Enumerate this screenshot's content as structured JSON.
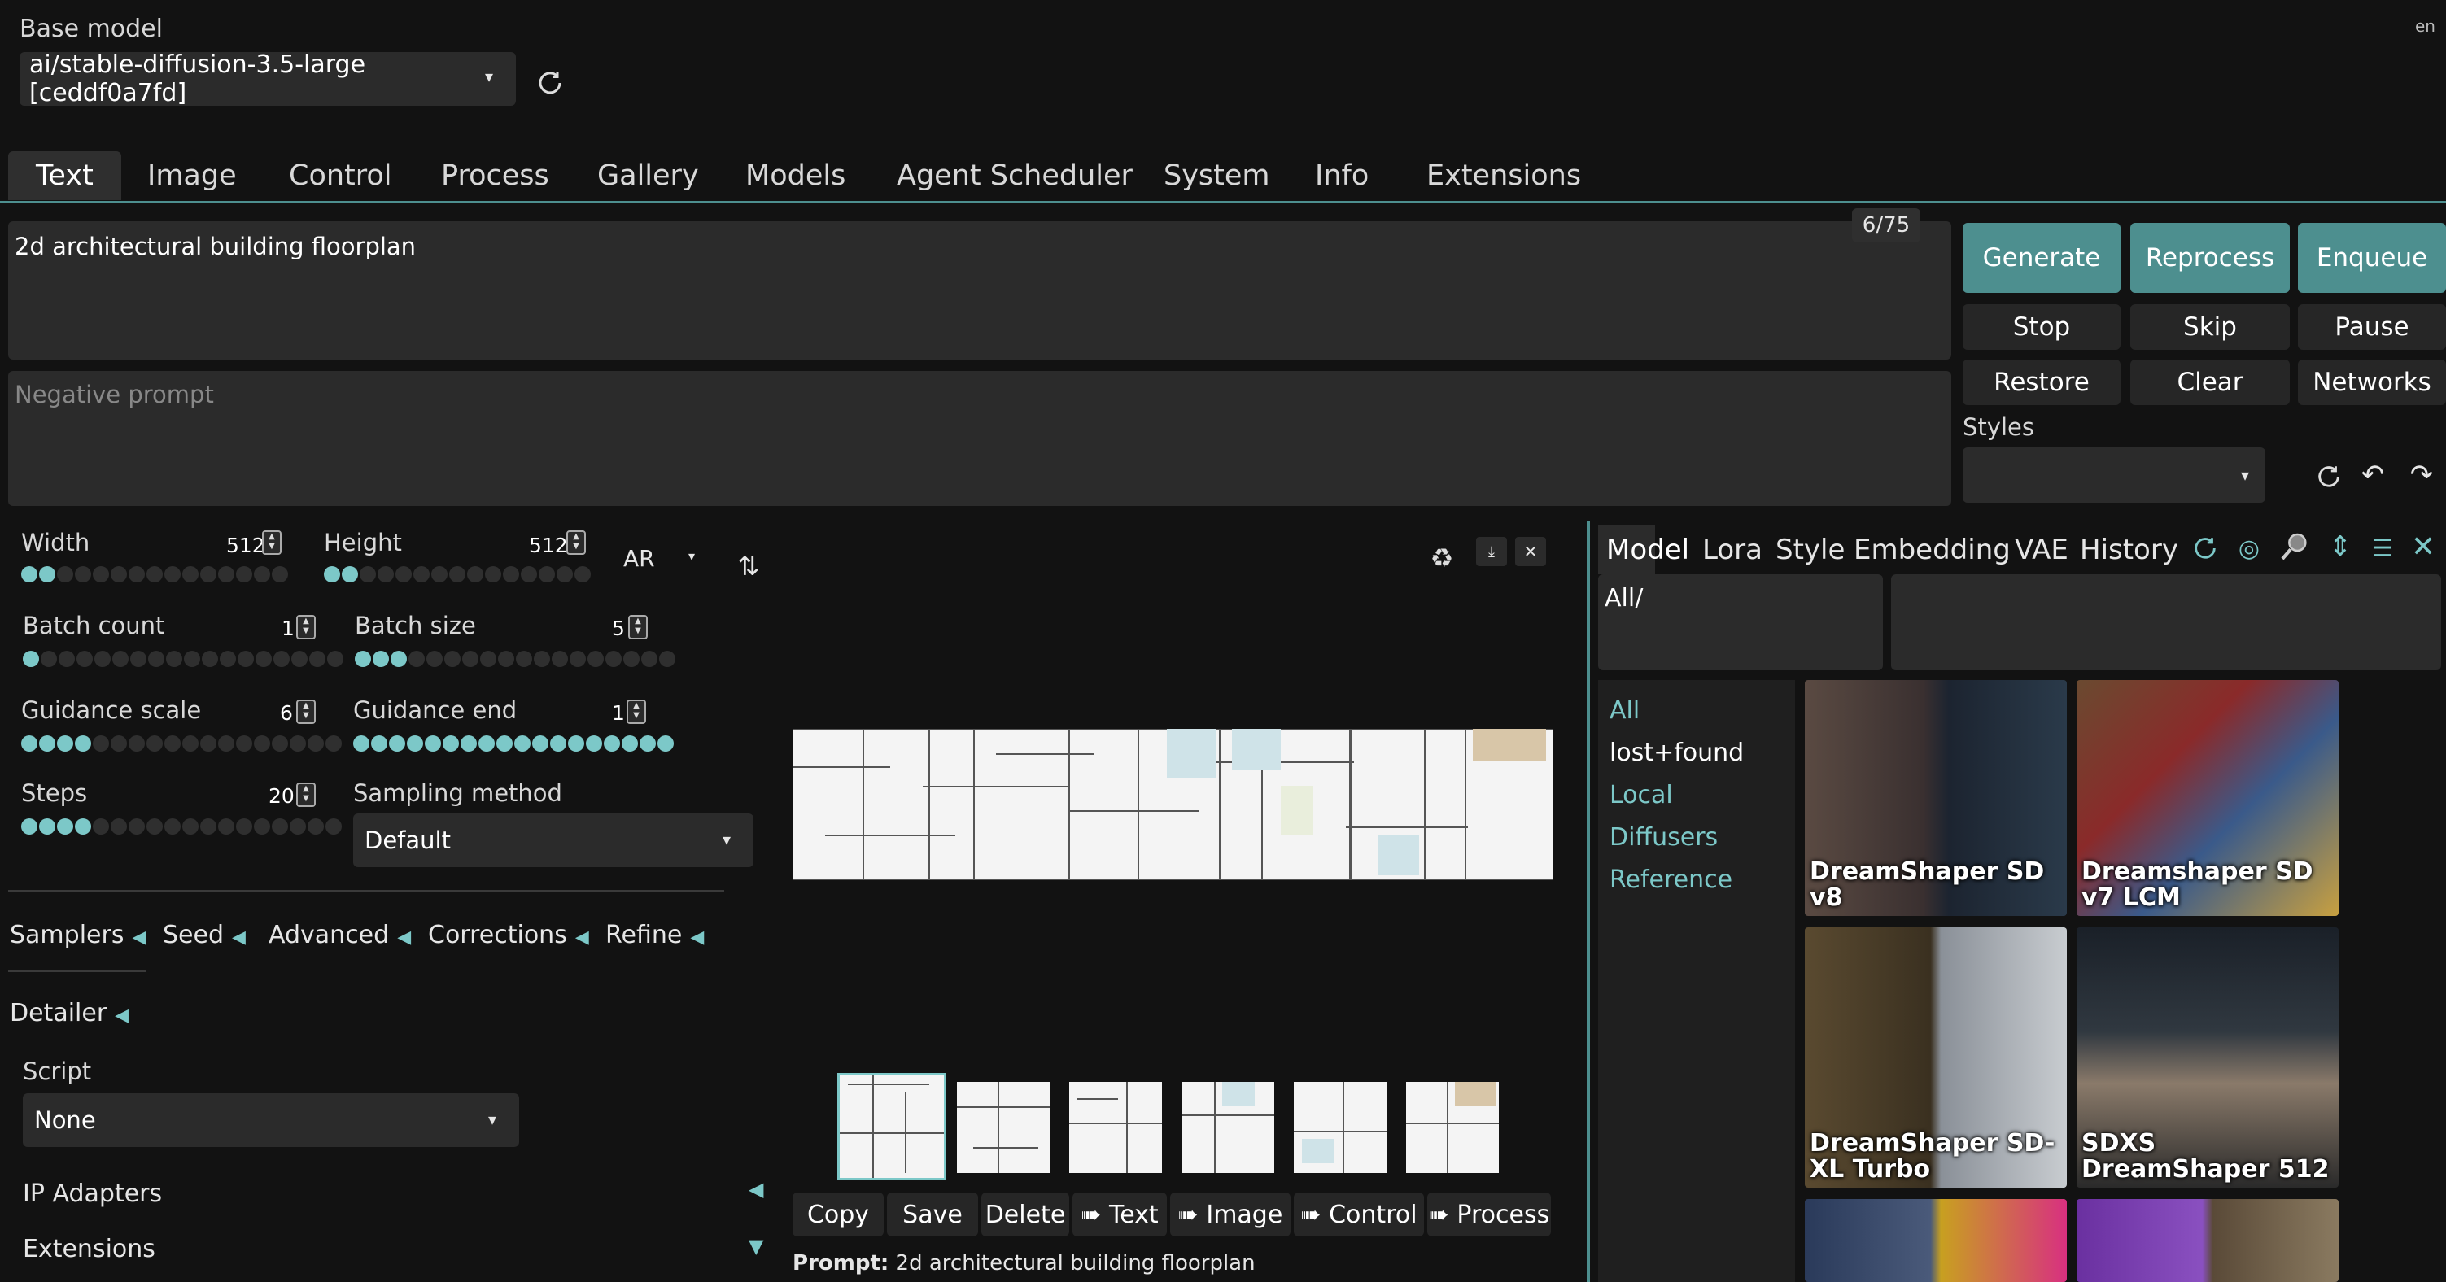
{
  "header": {
    "base_model_label": "Base model",
    "model_value": "ai/stable-diffusion-3.5-large [ceddf0a7fd]",
    "lang": "en"
  },
  "tabs": [
    {
      "label": "Text",
      "active": true
    },
    {
      "label": "Image"
    },
    {
      "label": "Control"
    },
    {
      "label": "Process"
    },
    {
      "label": "Gallery"
    },
    {
      "label": "Models"
    },
    {
      "label": "Agent Scheduler"
    },
    {
      "label": "System"
    },
    {
      "label": "Info"
    },
    {
      "label": "Extensions"
    }
  ],
  "prompt": {
    "value": "2d architectural building floorplan",
    "token_count": "6/75",
    "negative_placeholder": "Negative prompt"
  },
  "actions": {
    "generate": "Generate",
    "reprocess": "Reprocess",
    "enqueue": "Enqueue",
    "stop": "Stop",
    "skip": "Skip",
    "pause": "Pause",
    "restore": "Restore",
    "clear": "Clear",
    "networks": "Networks",
    "styles_label": "Styles"
  },
  "params": {
    "width_label": "Width",
    "width_value": "512",
    "height_label": "Height",
    "height_value": "512",
    "ar_label": "AR",
    "batch_count_label": "Batch count",
    "batch_count_value": "1",
    "batch_size_label": "Batch size",
    "batch_size_value": "5",
    "guidance_scale_label": "Guidance scale",
    "guidance_scale_value": "6",
    "guidance_end_label": "Guidance end",
    "guidance_end_value": "1",
    "steps_label": "Steps",
    "steps_value": "20",
    "sampling_label": "Sampling method",
    "sampling_value": "Default"
  },
  "accordions": {
    "samplers": "Samplers",
    "seed": "Seed",
    "advanced": "Advanced",
    "corrections": "Corrections",
    "refine": "Refine",
    "detailer": "Detailer",
    "script_label": "Script",
    "script_value": "None",
    "ip_adapters": "IP Adapters",
    "extensions": "Extensions"
  },
  "gallery": {
    "buttons": [
      "Copy",
      "Save",
      "Delete",
      "➠ Text",
      "➠ Image",
      "➠ Control",
      "➠ Process"
    ],
    "prompt_label": "Prompt:",
    "prompt_value": "2d architectural building floorplan"
  },
  "networks": {
    "tabs": [
      "Model",
      "Lora",
      "Style",
      "Embedding",
      "VAE",
      "History"
    ],
    "path": "All/",
    "folders": [
      "All",
      "lost+found",
      "Local",
      "Diffusers",
      "Reference"
    ],
    "cards": [
      {
        "label": "DreamShaper SD v8"
      },
      {
        "label": "Dreamshaper SD v7 LCM"
      },
      {
        "label": "DreamShaper SD-XL Turbo"
      },
      {
        "label": "SDXS DreamShaper 512"
      }
    ]
  },
  "colors": {
    "accent": "#4d8f8f",
    "accent_light": "#7cc8c8",
    "background": "#121212"
  }
}
